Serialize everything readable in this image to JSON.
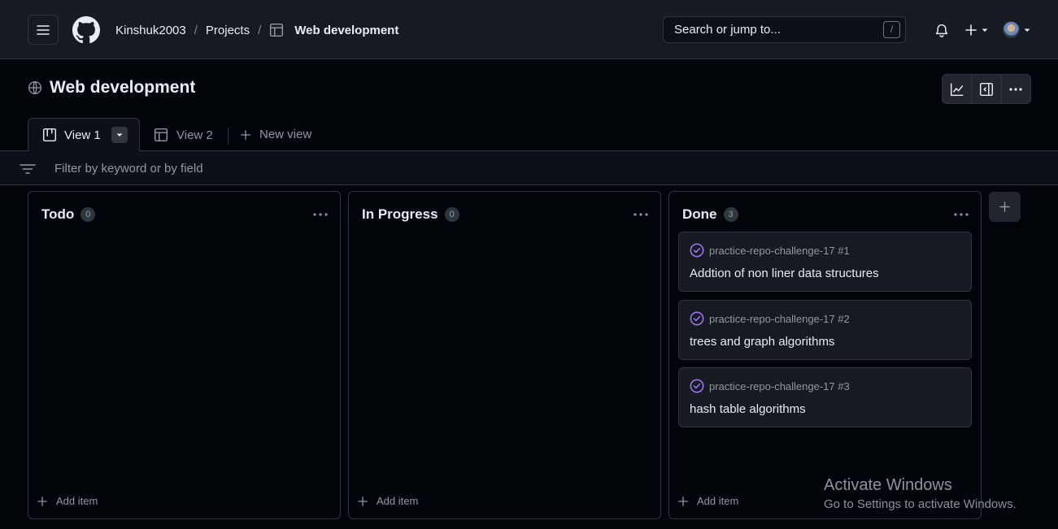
{
  "header": {
    "breadcrumb": [
      "Kinshuk2003",
      "Projects",
      "Web development"
    ],
    "search_placeholder": "Search or jump to...",
    "search_shortcut": "/"
  },
  "project": {
    "title": "Web development"
  },
  "tabs": [
    {
      "label": "View 1",
      "active": true
    },
    {
      "label": "View 2",
      "active": false
    }
  ],
  "new_view_label": "New view",
  "filter": {
    "placeholder": "Filter by keyword or by field"
  },
  "columns": [
    {
      "title": "Todo",
      "count": "0",
      "add_label": "Add item",
      "cards": []
    },
    {
      "title": "In Progress",
      "count": "0",
      "add_label": "Add item",
      "cards": []
    },
    {
      "title": "Done",
      "count": "3",
      "add_label": "Add item",
      "cards": [
        {
          "ref": "practice-repo-challenge-17 #1",
          "title": "Addtion of non liner data structures",
          "status": "closed"
        },
        {
          "ref": "practice-repo-challenge-17 #2",
          "title": "trees and graph algorithms",
          "status": "closed"
        },
        {
          "ref": "practice-repo-challenge-17 #3",
          "title": "hash table algorithms",
          "status": "closed"
        }
      ]
    }
  ],
  "watermark": {
    "line1": "Activate Windows",
    "line2": "Go to Settings to activate Windows."
  },
  "colors": {
    "background": "#010409",
    "header": "#161b22",
    "border": "#30363d",
    "done_purple": "#a371f7",
    "muted_text": "#9198a1"
  },
  "icons": [
    "hamburger-icon",
    "github-logo-icon",
    "table-icon",
    "bell-icon",
    "plus-icon",
    "globe-icon",
    "graph-icon",
    "sidebar-icon",
    "kebab-icon",
    "board-icon",
    "filter-icon",
    "check-circle-icon"
  ]
}
